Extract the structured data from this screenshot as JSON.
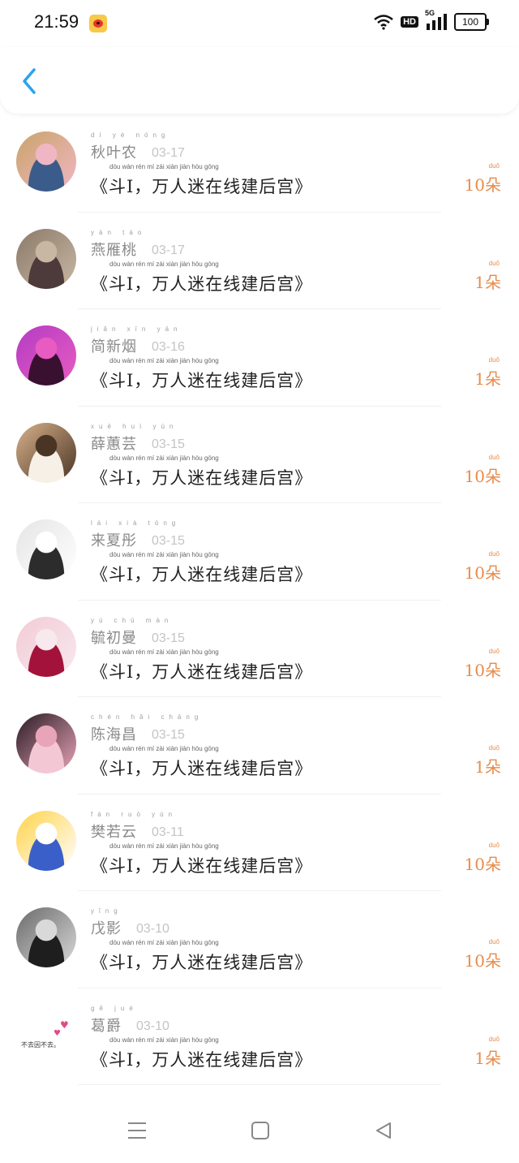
{
  "status_bar": {
    "time": "21:59",
    "network_label": "5G",
    "hd_label": "HD",
    "battery": "100"
  },
  "header": {
    "back_icon": "chevron-left-icon",
    "accent_color": "#2aa3ef"
  },
  "items": [
    {
      "name": "秋叶农",
      "pinyin": "dí yè nóng",
      "date": "03-17",
      "title": "《斗I，万人迷在线建后宫》",
      "title_pinyin": "dòu  wàn rén mí zài xiàn jiàn hòu gōng",
      "amount": "10朵",
      "amount_pinyin": "duǒ",
      "avatar_colors": [
        "#c9a46a",
        "#3b5b8a",
        "#f1b6c4"
      ]
    },
    {
      "name": "燕雁桃",
      "pinyin": "  yàn táo",
      "date": "03-17",
      "title": "《斗I，万人迷在线建后宫》",
      "title_pinyin": "dòu  wàn rén mí zài xiàn jiàn hòu gōng",
      "amount": "1朵",
      "amount_pinyin": "duǒ",
      "avatar_colors": [
        "#8c7a6a",
        "#4d3a3a",
        "#c7b7a3"
      ]
    },
    {
      "name": "简新烟",
      "pinyin": "jiǎn xīn yān",
      "date": "03-16",
      "title": "《斗I，万人迷在线建后宫》",
      "title_pinyin": "dòu  wàn rén mí zài xiàn jiàn hòu gōng",
      "amount": "1朵",
      "amount_pinyin": "duǒ",
      "avatar_colors": [
        "#b43cc4",
        "#3a1030",
        "#e85bc1"
      ]
    },
    {
      "name": "薛蕙芸",
      "pinyin": "xuē huì yún",
      "date": "03-15",
      "title": "《斗I，万人迷在线建后宫》",
      "title_pinyin": "dòu  wàn rén mí zài xiàn jiàn hòu gōng",
      "amount": "10朵",
      "amount_pinyin": "duǒ",
      "avatar_colors": [
        "#d7b08b",
        "#f6f0e6",
        "#4a3524"
      ]
    },
    {
      "name": "来夏彤",
      "pinyin": "lái xià tóng",
      "date": "03-15",
      "title": "《斗I，万人迷在线建后宫》",
      "title_pinyin": "dòu  wàn rén mí zài xiàn jiàn hòu gōng",
      "amount": "10朵",
      "amount_pinyin": "duǒ",
      "avatar_colors": [
        "#e5e5e5",
        "#2c2c2c",
        "#ffffff"
      ]
    },
    {
      "name": "毓初曼",
      "pinyin": "yù chū màn",
      "date": "03-15",
      "title": "《斗I，万人迷在线建后宫》",
      "title_pinyin": "dòu  wàn rén mí zài xiàn jiàn hòu gōng",
      "amount": "10朵",
      "amount_pinyin": "duǒ",
      "avatar_colors": [
        "#f3cbd6",
        "#a3123a",
        "#f7e9ee"
      ]
    },
    {
      "name": "陈海昌",
      "pinyin": "chén hǎi chāng",
      "date": "03-15",
      "title": "《斗I，万人迷在线建后宫》",
      "title_pinyin": "dòu  wàn rén mí zài xiàn jiàn hòu gōng",
      "amount": "1朵",
      "amount_pinyin": "duǒ",
      "avatar_colors": [
        "#2a1b24",
        "#f4c7d5",
        "#e8a4b8"
      ]
    },
    {
      "name": "樊若云",
      "pinyin": "fán ruò yún",
      "date": "03-11",
      "title": "《斗I，万人迷在线建后宫》",
      "title_pinyin": "dòu  wàn rén mí zài xiàn jiàn hòu gōng",
      "amount": "10朵",
      "amount_pinyin": "duǒ",
      "avatar_colors": [
        "#ffd34a",
        "#3b5fc8",
        "#ffffff"
      ]
    },
    {
      "name": "戊影",
      "pinyin": " yǐng",
      "date": "03-10",
      "title": "《斗I，万人迷在线建后宫》",
      "title_pinyin": "dòu  wàn rén mí zài xiàn jiàn hòu gōng",
      "amount": "10朵",
      "amount_pinyin": "duǒ",
      "avatar_colors": [
        "#6b6b6b",
        "#1e1e1e",
        "#d9d9d9"
      ]
    },
    {
      "name": "葛爵",
      "pinyin": "gě jué",
      "date": "03-10",
      "title": "《斗I，万人迷在线建后宫》",
      "title_pinyin": "dòu  wàn rén mí zài xiàn jiàn hòu gōng",
      "amount": "1朵",
      "amount_pinyin": "duǒ",
      "avatar_colors": [
        "#ffffff",
        "#e04b8c",
        "#333333"
      ],
      "avatar_text": "不去因不去。"
    }
  ],
  "nav": {
    "menu_icon": "menu-icon",
    "home_icon": "home-square-icon",
    "back_icon": "triangle-back-icon",
    "icon_color": "#888888"
  }
}
